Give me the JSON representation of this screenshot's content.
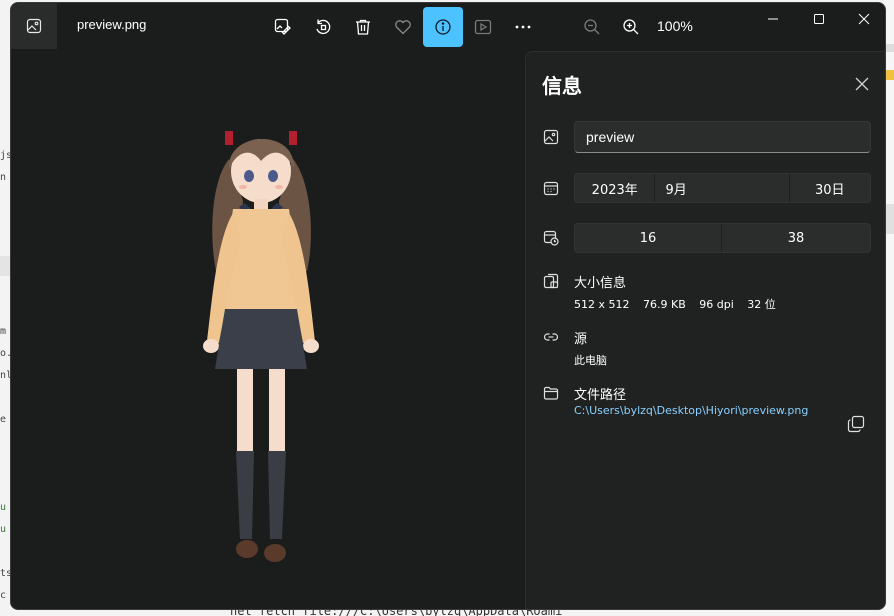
{
  "window": {
    "file_name": "preview.png",
    "zoom_level": "100%"
  },
  "toolbar": {
    "buttons": [
      "edit-image",
      "rotate",
      "delete",
      "favorite",
      "file-info",
      "slideshow",
      "more-options",
      "zoom-out",
      "zoom-in"
    ],
    "active_button": "file-info",
    "accent_color": "#4cc2ff"
  },
  "info_panel": {
    "title": "信息",
    "name_value": "preview",
    "date": {
      "year": "2023年",
      "month": "9月",
      "day": "30日"
    },
    "time": {
      "hour": "16",
      "minute": "38"
    },
    "size": {
      "label": "大小信息",
      "dimensions": "512 x 512",
      "file_size": "76.9 KB",
      "dpi": "96 dpi",
      "bit_depth": "32 位"
    },
    "source": {
      "label": "源",
      "value": "此电脑"
    },
    "path": {
      "label": "文件路径",
      "value": "C:\\Users\\bylzq\\Desktop\\Hiyori\\preview.png"
    }
  },
  "background": {
    "bottom_text": "net fetch file:///C:\\Users\\bylzq\\AppData\\Roami"
  }
}
